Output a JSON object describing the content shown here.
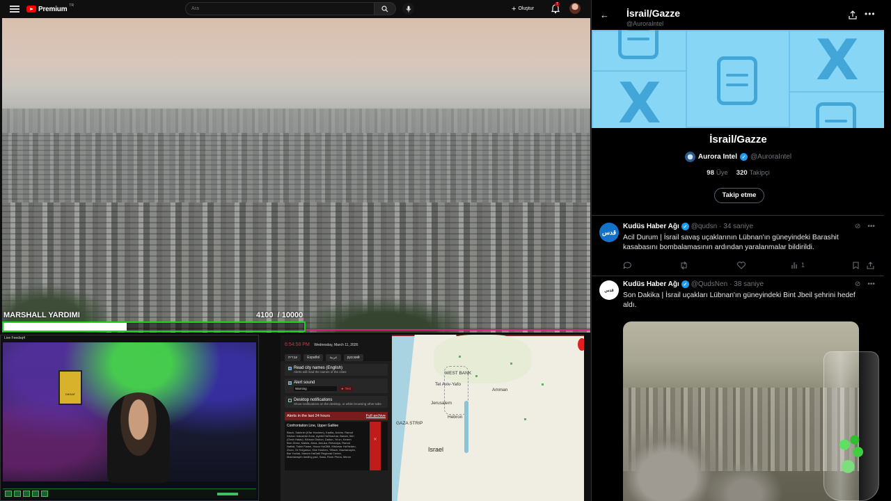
{
  "youtube": {
    "logo_text": "Premium",
    "logo_sup": "TR",
    "search_placeholder": "Ara",
    "create_label": "Oluştur",
    "notif_count": "7"
  },
  "marshall": {
    "label": "MARSHALL YARDIMI",
    "count_text": "4100  / 10000",
    "progress": 0.41
  },
  "cam": {
    "title": "Live Feedsq4",
    "sign_text": "DIKKAT"
  },
  "alerts": {
    "time": "6:54:58 PM",
    "date": "Wednesday, March 11, 2026",
    "languages": [
      "עברית",
      "Español",
      "عربية",
      "русский"
    ],
    "opt_city_title": "Read city names (English)",
    "opt_city_desc": "Alerts will read the names of the cities",
    "opt_sound_title": "Alert sound",
    "opt_sound_value": "Warning",
    "opt_sound_test": "► Test",
    "opt_desktop_title": "Desktop notifications",
    "opt_desktop_desc": "Show notifications on the desktop, or while browsing other tabs",
    "last24": "Alerts in the last 24 hours",
    "archive": "Full archive",
    "list_title": "Confrontation Line, Upper Galilee",
    "list_text": "Biach, Sakhnin (Kfar Hoshem), Kadita, Avivim, Ramot Dishon Industrial Zone, Ayelet HaShachar, Baram, Itkh (Gesh Halav), Kibbutz Dishon, Dalton, Yir'on, Kerem Ben Zimra, Malkia, Alma, Amuka, Rehaniya, Ramot Naftali, Taleh Flame, Hazor HaGlilit, Mishmar HaYarden, Zivon, Or Ha'ganuz, Kfar Hoshen, Yiftach, Machanayim, Bar Yochai, Marom HaGalil Regional Center, Machanayim landing pad, Sasa, Rosh Pinna, Meron"
  },
  "map": {
    "labels": {
      "tel_aviv": "Tel Aviv-Yafo",
      "west_bank": "WEST BANK",
      "amman": "Amman",
      "jerusalem": "Jerusalem",
      "gaza": "GAZA STRIP",
      "hebron": "Hebron",
      "israel": "Israel"
    }
  },
  "x": {
    "header_title": "İsrail/Gazze",
    "header_handle": "@AuroraIntel",
    "list_title": "İsrail/Gazze",
    "owner_name": "Aurora Intel",
    "owner_handle": "@AuroraIntel",
    "members_count": "98",
    "members_label": "Üye",
    "followers_count": "320",
    "followers_label": "Takipçi",
    "follow_button": "Takip etme",
    "tweets": [
      {
        "avatar_text": "قدس",
        "name": "Kudüs Haber Ağı",
        "handle": "@qudsn",
        "time": "· 34 saniye",
        "text": "Acil Durum | İsrail savaş uçaklarının Lübnan'ın güneyindeki Barashit kasabasını bombalamasının ardından yaralanmalar bildirildi.",
        "views": "1"
      },
      {
        "avatar_text": "قدس",
        "name": "Kudüs Haber Ağı",
        "handle": "@QudsNen",
        "time": "· 38 saniye",
        "text": "Son Dakika | İsrail uçakları Lübnan'ın güneyindeki Bint Jbeil şehrini hedef aldı."
      }
    ]
  },
  "colors": {
    "x_blue": "#1d9bf0",
    "yt_red": "#ff0000",
    "progress_green": "#1fd11f",
    "alert_red": "#e03030"
  }
}
